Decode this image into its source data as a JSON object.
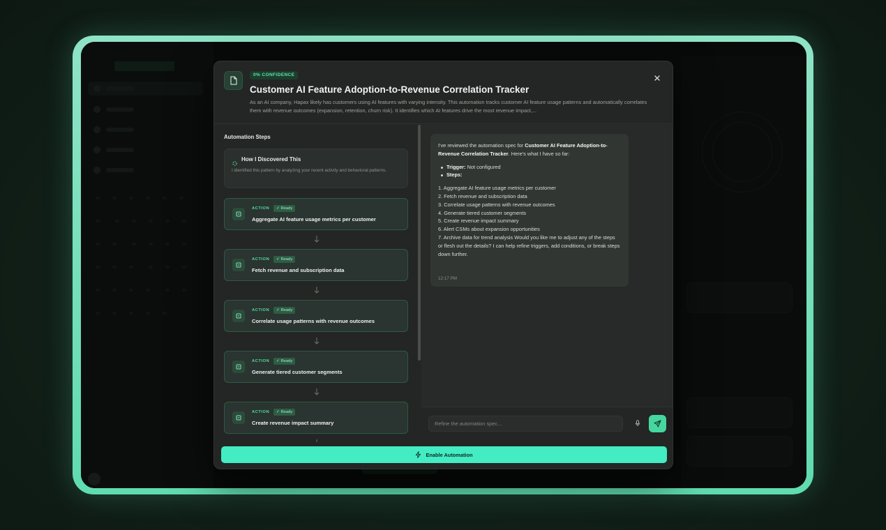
{
  "colors": {
    "accent": "#43ecc3",
    "frame": "#6fe0b9",
    "ready_badge": "#2e5c44",
    "action_text": "#4fdca0"
  },
  "modal": {
    "confidence_badge": "0% CONFIDENCE",
    "title": "Customer AI Feature Adoption-to-Revenue Correlation Tracker",
    "description": "As an AI company, Hapax likely has customers using AI features with varying intensity. This automation tracks customer AI feature usage patterns and automatically correlates them with revenue outcomes (expansion, retention, churn risk). It identifies which AI features drive the most revenue impact,...",
    "icon": "document-icon",
    "close_icon": "close-icon"
  },
  "steps_panel": {
    "heading": "Automation Steps",
    "discovered": {
      "title": "How I Discovered This",
      "text": "I identified this pattern by analyzing your recent activity and behavioral patterns."
    },
    "steps": [
      {
        "kind": "ACTION",
        "status": "✓ Ready",
        "label": "Aggregate AI feature usage metrics per customer"
      },
      {
        "kind": "ACTION",
        "status": "✓ Ready",
        "label": "Fetch revenue and subscription data"
      },
      {
        "kind": "ACTION",
        "status": "✓ Ready",
        "label": "Correlate usage patterns with revenue outcomes"
      },
      {
        "kind": "ACTION",
        "status": "✓ Ready",
        "label": "Generate tiered customer segments"
      },
      {
        "kind": "ACTION",
        "status": "✓ Ready",
        "label": "Create revenue impact summary"
      }
    ]
  },
  "chat": {
    "intro_prefix": "I've reviewed the automation spec for ",
    "intro_bold": "Customer AI Feature Adoption-to-Revenue Correlation Tracker",
    "intro_suffix": ". Here's what I have so far:",
    "trigger_label": "Trigger:",
    "trigger_value": " Not configured",
    "steps_label": "Steps:",
    "list": [
      "1. Aggregate AI feature usage metrics per customer",
      "2. Fetch revenue and subscription data",
      "3. Correlate usage patterns with revenue outcomes",
      "4. Generate tiered customer segments",
      "5. Create revenue impact summary",
      "6. Alert CSMs about expansion opportunities",
      "7. Archive data for trend analysis Would you like me to adjust any of the steps or flesh out the details? I can help refine triggers, add conditions, or break steps down further."
    ],
    "time": "12:17 PM"
  },
  "composer": {
    "placeholder": "Refine the automation spec...",
    "mic_icon": "microphone-icon",
    "send_icon": "send-icon"
  },
  "enable_button": {
    "label": "Enable Automation",
    "icon": "lightning-icon"
  }
}
